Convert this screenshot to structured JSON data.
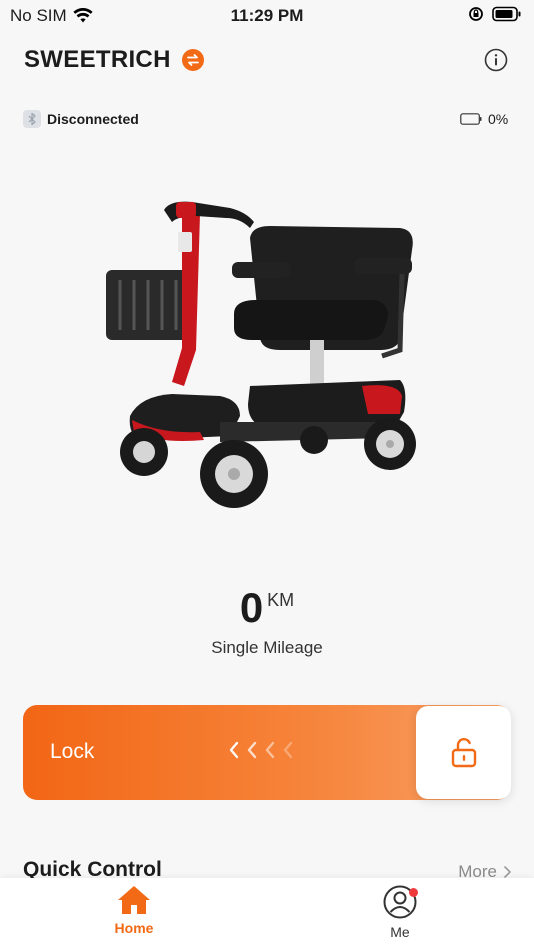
{
  "status_bar": {
    "carrier": "No SIM",
    "time": "11:29 PM"
  },
  "header": {
    "title": "SWEETRICH"
  },
  "connection": {
    "status": "Disconnected",
    "battery": "0%"
  },
  "mileage": {
    "value": "0",
    "unit": "KM",
    "label": "Single Mileage"
  },
  "lock": {
    "label": "Lock",
    "state": "unlocked"
  },
  "quick_control": {
    "title": "Quick Control",
    "more": "More"
  },
  "tabs": [
    {
      "label": "Home",
      "active": true
    },
    {
      "label": "Me",
      "active": false
    }
  ],
  "colors": {
    "accent": "#f26a16",
    "background": "#f7f7f7",
    "notification": "#ef3b3b"
  },
  "icons": [
    "wifi-icon",
    "orientation-lock-icon",
    "battery-icon",
    "swap-icon",
    "info-icon",
    "bluetooth-icon",
    "lock-open-icon",
    "chevron-right-icon",
    "home-icon",
    "profile-icon"
  ]
}
